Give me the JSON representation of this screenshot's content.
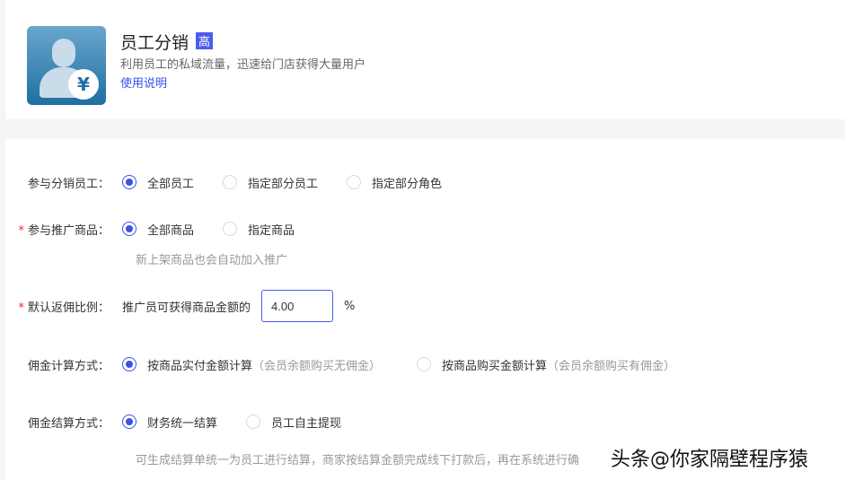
{
  "header": {
    "title": "员工分销",
    "badge": "高",
    "description": "利用员工的私域流量，迅速给门店获得大量用户",
    "help_link": "使用说明"
  },
  "form": {
    "staff": {
      "label": "参与分销员工：",
      "options": [
        "全部员工",
        "指定部分员工",
        "指定部分角色"
      ],
      "selected": 0
    },
    "products": {
      "label": "参与推广商品：",
      "required": true,
      "options": [
        "全部商品",
        "指定商品"
      ],
      "selected": 0,
      "hint": "新上架商品也会自动加入推广"
    },
    "rate": {
      "label": "默认返佣比例：",
      "required": true,
      "prefix": "推广员可获得商品金额的",
      "value": "4.00",
      "unit": "%"
    },
    "calc": {
      "label": "佣金计算方式：",
      "options": [
        {
          "text": "按商品实付金额计算",
          "note": "（会员余额购买无佣金）"
        },
        {
          "text": "按商品购买金额计算",
          "note": "（会员余额购买有佣金）"
        }
      ],
      "selected": 0
    },
    "settle": {
      "label": "佣金结算方式：",
      "options": [
        "财务统一结算",
        "员工自主提现"
      ],
      "selected": 0,
      "hint": "可生成结算单统一为员工进行结算，商家按结算金额完成线下打款后，再在系统进行确"
    }
  },
  "watermark": "头条@你家隔壁程序猿",
  "colors": {
    "accent": "#3f51e6",
    "link": "#2f54eb",
    "required": "#f5222d"
  }
}
